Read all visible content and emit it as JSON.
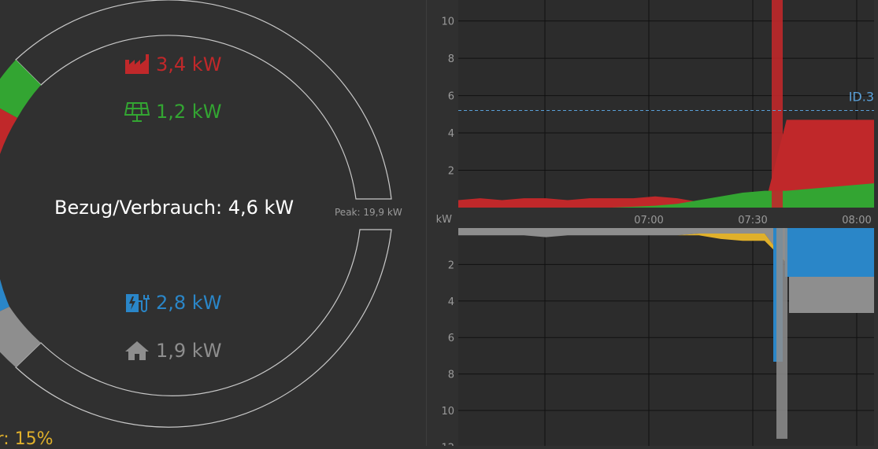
{
  "gauge": {
    "center_label": "Bezug/Verbrauch: 4,6 kW",
    "peak_label": "Peak: 19,9 kW",
    "share_label": "er: 15%",
    "readings": [
      {
        "key": "grid",
        "value": "3,4 kW",
        "icon": "factory-icon",
        "color": "#c0282a"
      },
      {
        "key": "solar",
        "value": "1,2 kW",
        "icon": "solar-panel-icon",
        "color": "#33a532"
      },
      {
        "key": "wallbox",
        "value": "2,8 kW",
        "icon": "ev-charger-icon",
        "color": "#2a86c8"
      },
      {
        "key": "house",
        "value": "1,9 kW",
        "icon": "house-icon",
        "color": "#8e8e8e"
      }
    ],
    "peak_kw": 19.9,
    "consumption_kw": 4.6
  },
  "colors": {
    "grid": "#c0282a",
    "solar": "#33a532",
    "wallbox": "#2a86c8",
    "house": "#8e8e8e",
    "battery": "#e0b02b",
    "reference": "#5aa0d8",
    "background": "#303030"
  },
  "chart_data": [
    {
      "type": "area",
      "yunit": "",
      "ylim": [
        0,
        11
      ],
      "yticks": [
        "2",
        "4",
        "6",
        "8",
        "10"
      ],
      "x_labels": [
        "07:00",
        "07:30",
        "08:00"
      ],
      "grid": true,
      "reference_line": {
        "label": "ID.3",
        "value": 5.2
      },
      "series": [],
      "x": [
        "06:25",
        "06:30",
        "06:35",
        "06:40",
        "06:45",
        "06:50",
        "06:55",
        "07:00",
        "07:05",
        "07:10",
        "07:15",
        "07:20",
        "07:25",
        "07:30",
        "07:35",
        "07:40",
        "07:45",
        "07:50",
        "07:55",
        "08:00"
      ],
      "values_grid": [
        0.4,
        0.5,
        0.4,
        0.5,
        0.5,
        0.4,
        0.5,
        0.5,
        0.5,
        0.6,
        0.5,
        0.3,
        0.2,
        0.1,
        0.1,
        4.7,
        4.7,
        4.7,
        4.7,
        4.7
      ],
      "values_solar": [
        0,
        0,
        0,
        0,
        0,
        0,
        0,
        0,
        0.05,
        0.1,
        0.2,
        0.4,
        0.6,
        0.8,
        0.9,
        0.9,
        1.0,
        1.1,
        1.2,
        1.3
      ]
    },
    {
      "type": "area",
      "yunit": "kW",
      "ylim": [
        0,
        12
      ],
      "yticks": [
        "2",
        "4",
        "6",
        "8",
        "10",
        "12"
      ],
      "grid": true,
      "series": [],
      "x": [
        "06:25",
        "06:30",
        "06:35",
        "06:40",
        "06:45",
        "06:50",
        "06:55",
        "07:00",
        "07:05",
        "07:10",
        "07:15",
        "07:20",
        "07:25",
        "07:30",
        "07:35",
        "07:40",
        "07:45",
        "07:50",
        "07:55",
        "08:00"
      ],
      "values_house": [
        0.4,
        0.4,
        0.4,
        0.4,
        0.5,
        0.4,
        0.4,
        0.4,
        0.4,
        0.4,
        0.4,
        0.3,
        0.3,
        0.3,
        0.3,
        1.9,
        1.9,
        1.9,
        1.9,
        1.9
      ],
      "values_battery": [
        0,
        0,
        0,
        0,
        0,
        0,
        0,
        0,
        0,
        0,
        0,
        0.1,
        0.3,
        0.4,
        0.4,
        0,
        0,
        0,
        0,
        0
      ],
      "values_wallbox": [
        0,
        0,
        0,
        0,
        0,
        0,
        0,
        0,
        0,
        0,
        0,
        0,
        0,
        0,
        0,
        2.8,
        2.8,
        2.8,
        2.8,
        2.8
      ]
    }
  ]
}
